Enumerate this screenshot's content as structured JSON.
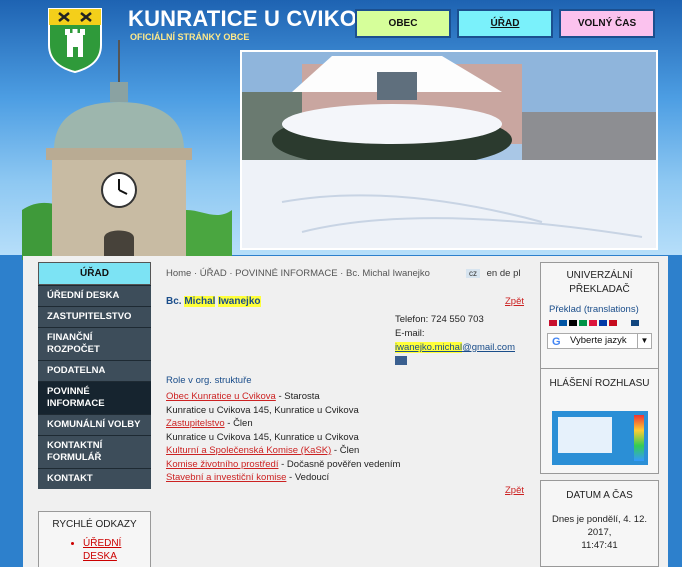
{
  "header": {
    "title": "KUNRATICE U CVIKOVA",
    "subtitle": "OFICIÁLNÍ STRÁNKY OBCE",
    "nav": [
      {
        "label": "OBEC"
      },
      {
        "label": "ÚŘAD"
      },
      {
        "label": "VOLNÝ ČAS"
      }
    ]
  },
  "sidebar": {
    "heading": "ÚŘAD",
    "items": [
      {
        "label": "Úřední deska"
      },
      {
        "label": "Zastupitelstvo"
      },
      {
        "label": "Finanční rozpočet"
      },
      {
        "label": "Podatelna"
      },
      {
        "label": "Povinné informace"
      },
      {
        "label": "Komunální volby"
      },
      {
        "label": "Kontaktní formulář"
      },
      {
        "label": "Kontakt"
      }
    ],
    "quick_links": {
      "title": "RYCHLÉ ODKAZY",
      "items": [
        {
          "label": "ÚŘEDNÍ"
        },
        {
          "label": "DESKA"
        }
      ]
    }
  },
  "breadcrumb": "Home · ÚŘAD · POVINNÉ INFORMACE · Bc. Michal Iwanejko",
  "languages": {
    "cz": "cz",
    "en": "en",
    "de": "de",
    "pl": "pl"
  },
  "person": {
    "prefix": "Bc.",
    "first": "Michal",
    "last": "Iwanejko",
    "back_label": "Zpět",
    "phone": "Telefon: 724 550 703",
    "email_label": "E-mail:",
    "email_user": "iwanejko.michal",
    "email_domain": "@gmail.com"
  },
  "roles": {
    "title": "Role v org. struktuře",
    "entries": [
      {
        "link": "Obec Kunratice u Cvikova",
        "rest": " - Starosta"
      },
      {
        "text": "Kunratice u Cvikova 145, Kunratice u Cvikova"
      },
      {
        "link": "Zastupitelstvo",
        "rest": " - Člen"
      },
      {
        "text": "Kunratice u Cvikova 145, Kunratice u Cvikova"
      },
      {
        "link": "Kulturní a Společenská Komise (KaSK)",
        "rest": " - Člen"
      },
      {
        "link": "Komise životního prostředí",
        "rest": " - Dočasně pověřen vedením"
      },
      {
        "link": "Stavební a investiční komise",
        "rest": " - Vedoucí"
      }
    ]
  },
  "right": {
    "translator_title": "UNIVERZÁLNÍ PŘEKLADAČ",
    "translate_label": "Překlad (translations)",
    "select_value": "Vyberte jazyk",
    "broadcast_title": "HLÁŠENÍ ROZHLASU",
    "datetime_title": "DATUM A ČAS",
    "date_text": "Dnes je pondělí, 4. 12. 2017,",
    "time_text": "11:47:41"
  },
  "colors": {
    "accent": "#2d80cc",
    "link": "#cc2222",
    "highlight": "#ffff3a"
  }
}
